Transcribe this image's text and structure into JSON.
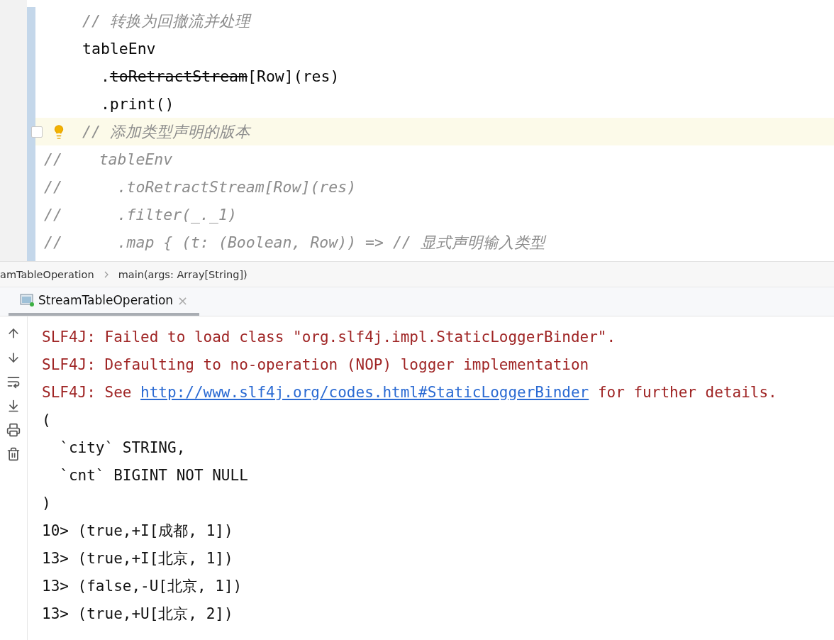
{
  "editor": {
    "lines": [
      {
        "kind": "comment",
        "current": false,
        "segments": [
          {
            "kind": "plain",
            "text": "// 转换为回撤流并处理"
          }
        ]
      },
      {
        "kind": "code",
        "current": false,
        "segments": [
          {
            "kind": "plain",
            "text": "tableEnv"
          }
        ]
      },
      {
        "kind": "code",
        "current": false,
        "segments": [
          {
            "kind": "plain",
            "text": "  ."
          },
          {
            "kind": "deprecated",
            "text": "toRetractStream"
          },
          {
            "kind": "plain",
            "text": "[Row](res)"
          }
        ]
      },
      {
        "kind": "code",
        "current": false,
        "segments": [
          {
            "kind": "plain",
            "text": "  .print()"
          }
        ]
      },
      {
        "kind": "comment",
        "current": true,
        "segments": [
          {
            "kind": "plain",
            "text": "// 添加类型声明的版本"
          }
        ]
      },
      {
        "kind": "commented_code",
        "current": false,
        "segments": [
          {
            "kind": "plain",
            "text": "//    tableEnv"
          }
        ]
      },
      {
        "kind": "commented_code",
        "current": false,
        "segments": [
          {
            "kind": "plain",
            "text": "//      .toRetractStream[Row](res)"
          }
        ]
      },
      {
        "kind": "commented_code",
        "current": false,
        "segments": [
          {
            "kind": "plain",
            "text": "//      .filter(_._1)"
          }
        ]
      },
      {
        "kind": "commented_code",
        "current": false,
        "segments": [
          {
            "kind": "plain",
            "text": "//      .map { (t: (Boolean, Row)) => // 显式声明输入类型"
          }
        ]
      }
    ]
  },
  "breadcrumbs": [
    "amTableOperation",
    "main(args: Array[String])"
  ],
  "run_tabs": [
    {
      "label": "StreamTableOperation",
      "selected": true,
      "close": "×"
    }
  ],
  "console": {
    "lines": [
      {
        "kind": "error",
        "segments": [
          {
            "kind": "plain",
            "text": "SLF4J: Failed to load class \"org.slf4j.impl.StaticLoggerBinder\"."
          }
        ]
      },
      {
        "kind": "error",
        "segments": [
          {
            "kind": "plain",
            "text": "SLF4J: Defaulting to no-operation (NOP) logger implementation"
          }
        ]
      },
      {
        "kind": "error",
        "segments": [
          {
            "kind": "plain",
            "text": "SLF4J: See "
          },
          {
            "kind": "link",
            "text": "http://www.slf4j.org/codes.html#StaticLoggerBinder"
          },
          {
            "kind": "plain",
            "text": " for further details."
          }
        ]
      },
      {
        "kind": "output",
        "segments": [
          {
            "kind": "plain",
            "text": "("
          }
        ]
      },
      {
        "kind": "output",
        "segments": [
          {
            "kind": "plain",
            "text": "  `city` STRING,"
          }
        ]
      },
      {
        "kind": "output",
        "segments": [
          {
            "kind": "plain",
            "text": "  `cnt` BIGINT NOT NULL"
          }
        ]
      },
      {
        "kind": "output",
        "segments": [
          {
            "kind": "plain",
            "text": ")"
          }
        ]
      },
      {
        "kind": "output",
        "segments": [
          {
            "kind": "plain",
            "text": "10> (true,+I[成都, 1])"
          }
        ]
      },
      {
        "kind": "output",
        "segments": [
          {
            "kind": "plain",
            "text": "13> (true,+I[北京, 1])"
          }
        ]
      },
      {
        "kind": "output",
        "segments": [
          {
            "kind": "plain",
            "text": "13> (false,-U[北京, 1])"
          }
        ]
      },
      {
        "kind": "output",
        "segments": [
          {
            "kind": "plain",
            "text": "13> (true,+U[北京, 2])"
          }
        ]
      }
    ]
  }
}
